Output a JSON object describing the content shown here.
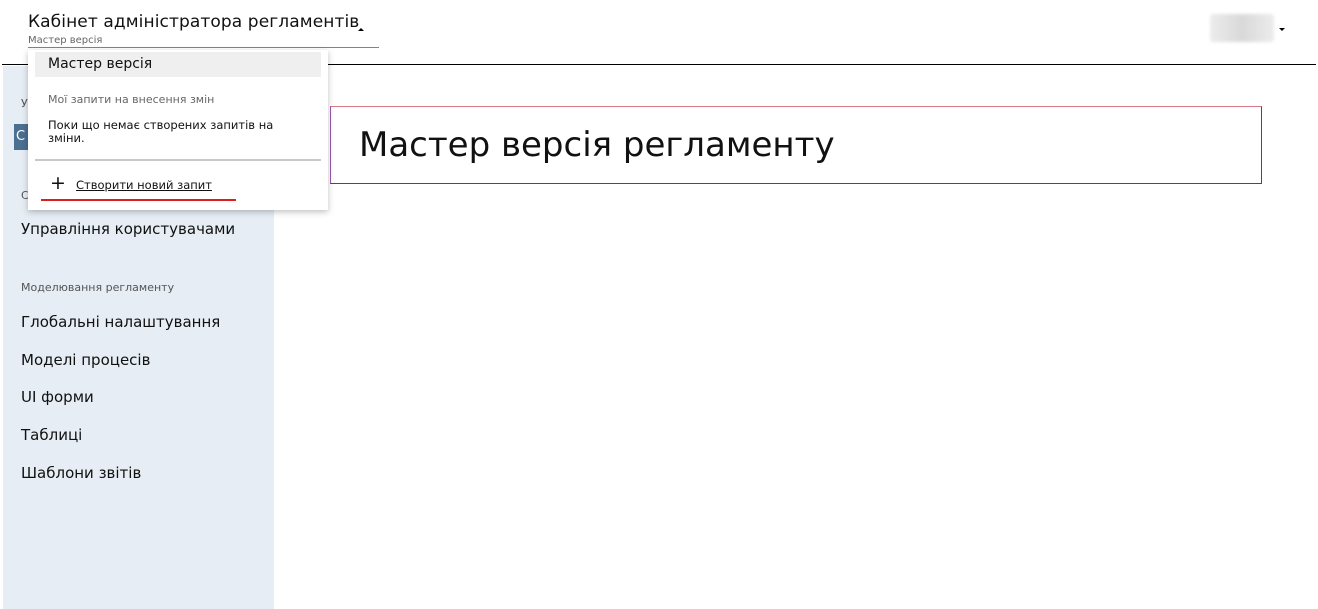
{
  "header": {
    "title": "Кабінет адміністратора регламентів",
    "subtitle": "Мастер версія"
  },
  "dropdown": {
    "selected_label": "Мастер версія",
    "section_label": "Мої запити на внесення змін",
    "empty_text": "Поки що немає створених запитів на зміни.",
    "create_label": "Створити новий запит",
    "create_icon": "plus-icon"
  },
  "sidebar": {
    "peek_letters": [
      "У",
      "С",
      "С"
    ],
    "users_item": "Управління користувачами",
    "section_modeling": "Моделювання регламенту",
    "items": [
      {
        "label": "Глобальні налаштування"
      },
      {
        "label": "Моделі процесів"
      },
      {
        "label": "UI форми"
      },
      {
        "label": "Таблиці"
      },
      {
        "label": "Шаблони звітів"
      }
    ]
  },
  "main": {
    "heading": "Мастер версія регламенту"
  },
  "colors": {
    "sidebar_bg": "#e6edf4",
    "accent": "#4a6f90",
    "highlight_red": "#d9201f",
    "heading_border": "#3b3bd6"
  }
}
